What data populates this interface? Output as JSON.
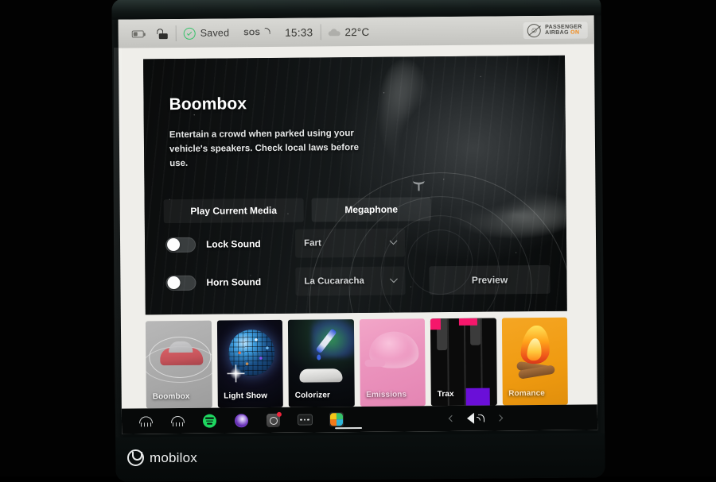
{
  "statusbar": {
    "battery_icon": "battery-icon",
    "lock_icon": "lock-open-icon",
    "saved_check_icon": "check-circle-icon",
    "saved_label": "Saved",
    "sos_label": "SOS",
    "clock": "15:33",
    "weather_icon": "cloud-icon",
    "temperature": "22°C",
    "airbag": {
      "icon": "passenger-airbag-off-icon",
      "line1": "PASSENGER",
      "line2": "AIRBAG",
      "status": "ON",
      "status_color": "#f08a1d"
    }
  },
  "hero": {
    "title": "Boombox",
    "description": "Entertain a crowd when parked using your vehicle's speakers. Check local laws before use.",
    "background_icon": "tesla-front-photo",
    "emblem_icon": "tesla-t-icon",
    "sound_rings_icon": "sound-wave-rings-icon"
  },
  "tabs": [
    {
      "label": "Play Current Media",
      "name": "tab-play-current-media"
    },
    {
      "label": "Megaphone",
      "name": "tab-megaphone"
    }
  ],
  "controls": [
    {
      "toggle_label": "Lock Sound",
      "toggle_state": "off",
      "dropdown_value": "Fart",
      "dropdown_icon": "chevron-down-icon"
    },
    {
      "toggle_label": "Horn Sound",
      "toggle_state": "off",
      "dropdown_value": "La Cucaracha",
      "dropdown_icon": "chevron-down-icon"
    }
  ],
  "preview_button": "Preview",
  "tiles": [
    {
      "label": "Boombox",
      "icon": "car-soundwave-icon",
      "selected": true
    },
    {
      "label": "Light Show",
      "icon": "disco-ball-icon",
      "selected": false
    },
    {
      "label": "Colorizer",
      "icon": "eyedropper-car-icon",
      "selected": false
    },
    {
      "label": "Emissions",
      "icon": "whoopee-cushion-icon",
      "selected": false
    },
    {
      "label": "Trax",
      "icon": "piano-keys-icon",
      "selected": false
    },
    {
      "label": "Romance",
      "icon": "campfire-icon",
      "selected": false
    }
  ],
  "taskbar": {
    "icons": [
      "rear-defrost-icon",
      "front-defrost-icon",
      "spotify-icon",
      "media-app-icon",
      "camera-app-icon",
      "more-apps-icon",
      "toybox-app-icon"
    ],
    "prev_icon": "chevron-left-icon",
    "volume_icon": "volume-speaker-icon",
    "next_icon": "chevron-right-icon"
  },
  "watermark": {
    "logo_icon": "mobilox-logo-icon",
    "text": "mobilox"
  },
  "colors": {
    "accent_orange": "#f08a1d",
    "accent_green": "#37c26a",
    "screen_bg": "#efeeea",
    "card_bg": "#0c0d0d"
  }
}
